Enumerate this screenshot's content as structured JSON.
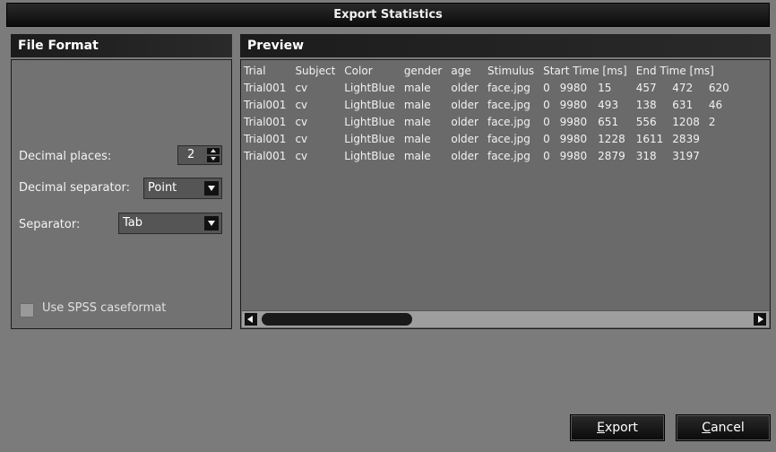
{
  "window": {
    "title": "Export Statistics"
  },
  "file_format": {
    "header": "File Format",
    "decimal_places_label": "Decimal places:",
    "decimal_places_value": "2",
    "decimal_separator_label": "Decimal separator:",
    "decimal_separator_value": "Point",
    "separator_label": "Separator:",
    "separator_value": "Tab",
    "spss_checkbox_label": "Use SPSS caseformat",
    "spss_checked": false
  },
  "preview": {
    "header": "Preview",
    "columns": [
      "Trial",
      "Subject",
      "Color",
      "gender",
      "age",
      "Stimulus",
      "Start Time [ms]",
      "End Time [ms]"
    ],
    "rows": [
      [
        "Trial001",
        "cv",
        "LightBlue",
        "male",
        "older",
        "face.jpg",
        "0",
        "9980",
        "15",
        "457",
        "472",
        "620"
      ],
      [
        "Trial001",
        "cv",
        "LightBlue",
        "male",
        "older",
        "face.jpg",
        "0",
        "9980",
        "493",
        "138",
        "631",
        "46"
      ],
      [
        "Trial001",
        "cv",
        "LightBlue",
        "male",
        "older",
        "face.jpg",
        "0",
        "9980",
        "651",
        "556",
        "1208",
        "2"
      ],
      [
        "Trial001",
        "cv",
        "LightBlue",
        "male",
        "older",
        "face.jpg",
        "0",
        "9980",
        "1228",
        "1611",
        "2839",
        ""
      ],
      [
        "Trial001",
        "cv",
        "LightBlue",
        "male",
        "older",
        "face.jpg",
        "0",
        "9980",
        "2879",
        "318",
        "3197",
        ""
      ]
    ]
  },
  "buttons": {
    "export_mnemonic": "E",
    "export_rest": "xport",
    "cancel_mnemonic": "C",
    "cancel_rest": "ancel"
  },
  "colors": {
    "background": "#7b7b7b",
    "header": "#1c1c1c",
    "text": "#ffffff"
  },
  "icons": [
    "spin-up-icon",
    "spin-down-icon",
    "dropdown-arrow-icon",
    "scroll-left-icon",
    "scroll-right-icon"
  ]
}
